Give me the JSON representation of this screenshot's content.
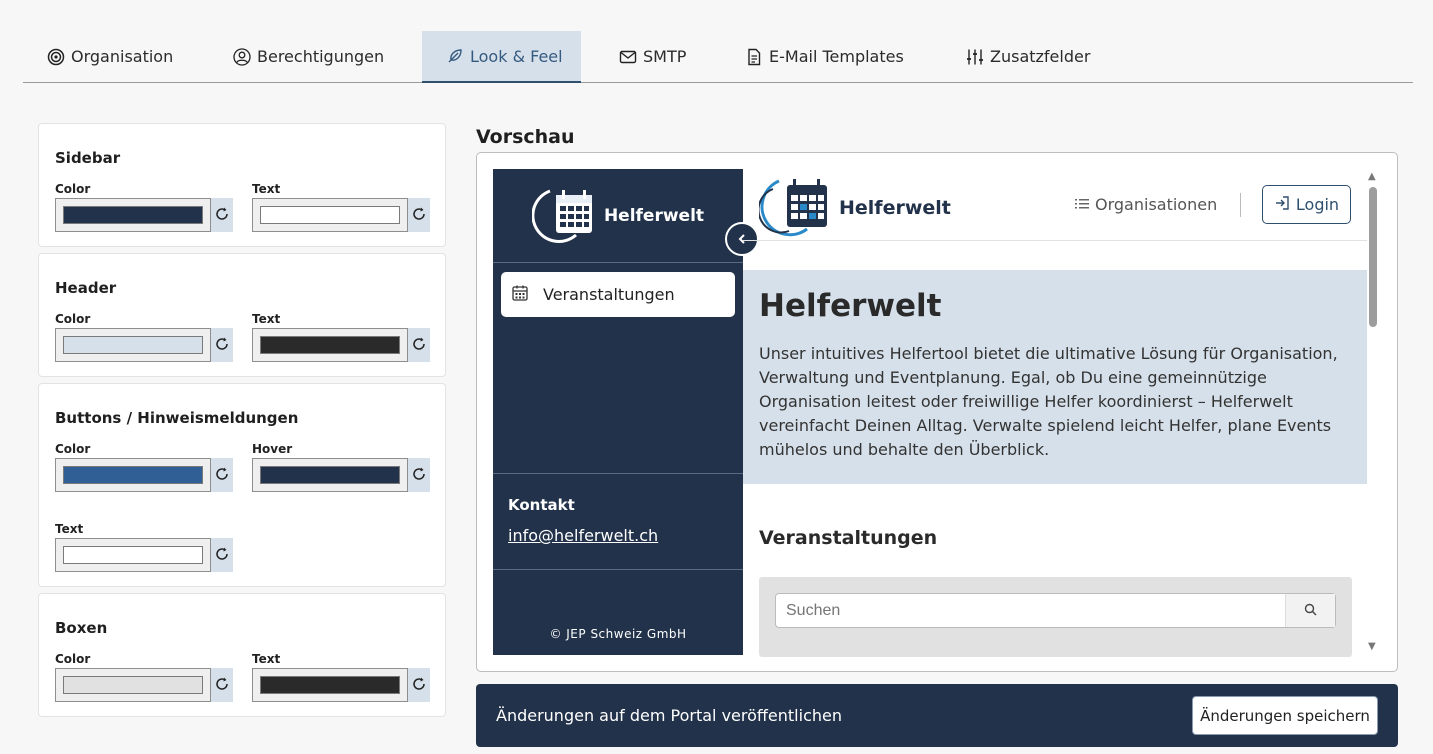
{
  "tabs": [
    {
      "label": "Organisation",
      "icon": "target-icon"
    },
    {
      "label": "Berechtigungen",
      "icon": "user-circle-icon"
    },
    {
      "label": "Look & Feel",
      "icon": "feather-icon"
    },
    {
      "label": "SMTP",
      "icon": "mail-icon"
    },
    {
      "label": "E-Mail Templates",
      "icon": "document-icon"
    },
    {
      "label": "Zusatzfelder",
      "icon": "sliders-icon"
    }
  ],
  "settings": {
    "sidebar": {
      "title": "Sidebar",
      "color_label": "Color",
      "color_value": "#22324a",
      "text_label": "Text",
      "text_value": "#ffffff"
    },
    "header": {
      "title": "Header",
      "color_label": "Color",
      "color_value": "#d6e0ea",
      "text_label": "Text",
      "text_value": "#2a2a2a"
    },
    "buttons": {
      "title": "Buttons / Hinweismeldungen",
      "color_label": "Color",
      "color_value": "#2f5f94",
      "hover_label": "Hover",
      "hover_value": "#22324a",
      "text_label": "Text",
      "text_value": "#ffffff"
    },
    "boxen": {
      "title": "Boxen",
      "color_label": "Color",
      "color_value": "#e1e1e1",
      "text_label": "Text",
      "text_value": "#2a2a2a"
    }
  },
  "preview": {
    "title": "Vorschau",
    "logo_text": "Helferwelt",
    "nav_item": "Veranstaltungen",
    "contact_title": "Kontakt",
    "contact_email": "info@helferwelt.ch",
    "copyright": "© JEP Schweiz GmbH",
    "header_orgs": "Organisationen",
    "header_login": "Login",
    "hero_title": "Helferwelt",
    "hero_text": "Unser intuitives Helfertool bietet die ultimative Lösung für Organisation, Verwaltung und Eventplanung. Egal, ob Du eine gemeinnützige Organisation leitest oder freiwillige Helfer koordinierst – Helferwelt vereinfacht Deinen Alltag. Verwalte spielend leicht Helfer, plane Events mühelos und behalte den Überblick.",
    "section_title": "Veranstaltungen",
    "search_placeholder": "Suchen"
  },
  "publish": {
    "text": "Änderungen auf dem Portal veröffentlichen",
    "save_label": "Änderungen speichern"
  }
}
